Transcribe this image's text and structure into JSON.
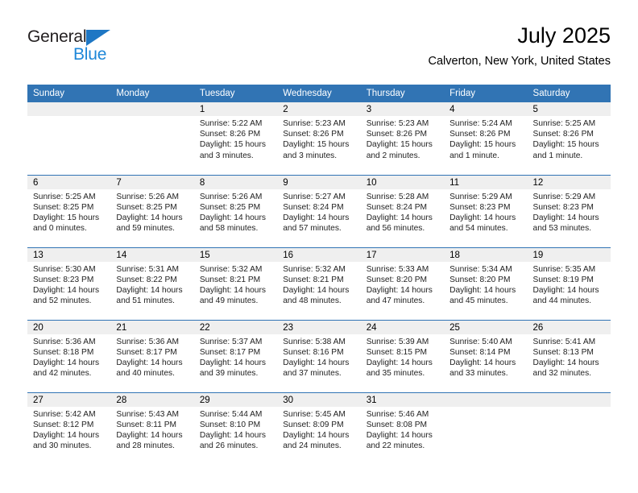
{
  "brand": {
    "name_part1": "General",
    "name_part2": "Blue",
    "triangle_color": "#1e77c4",
    "blue_color": "#1e87d8"
  },
  "header": {
    "title": "July 2025",
    "subtitle": "Calverton, New York, United States"
  },
  "theme": {
    "header_blue": "#3174b4",
    "daynum_band": "#efefef",
    "text": "#222222"
  },
  "weekday_headers": [
    "Sunday",
    "Monday",
    "Tuesday",
    "Wednesday",
    "Thursday",
    "Friday",
    "Saturday"
  ],
  "weeks": [
    [
      {
        "day": "",
        "sunrise": "",
        "sunset": "",
        "daylight1": "",
        "daylight2": ""
      },
      {
        "day": "",
        "sunrise": "",
        "sunset": "",
        "daylight1": "",
        "daylight2": ""
      },
      {
        "day": "1",
        "sunrise": "Sunrise: 5:22 AM",
        "sunset": "Sunset: 8:26 PM",
        "daylight1": "Daylight: 15 hours",
        "daylight2": "and 3 minutes."
      },
      {
        "day": "2",
        "sunrise": "Sunrise: 5:23 AM",
        "sunset": "Sunset: 8:26 PM",
        "daylight1": "Daylight: 15 hours",
        "daylight2": "and 3 minutes."
      },
      {
        "day": "3",
        "sunrise": "Sunrise: 5:23 AM",
        "sunset": "Sunset: 8:26 PM",
        "daylight1": "Daylight: 15 hours",
        "daylight2": "and 2 minutes."
      },
      {
        "day": "4",
        "sunrise": "Sunrise: 5:24 AM",
        "sunset": "Sunset: 8:26 PM",
        "daylight1": "Daylight: 15 hours",
        "daylight2": "and 1 minute."
      },
      {
        "day": "5",
        "sunrise": "Sunrise: 5:25 AM",
        "sunset": "Sunset: 8:26 PM",
        "daylight1": "Daylight: 15 hours",
        "daylight2": "and 1 minute."
      }
    ],
    [
      {
        "day": "6",
        "sunrise": "Sunrise: 5:25 AM",
        "sunset": "Sunset: 8:25 PM",
        "daylight1": "Daylight: 15 hours",
        "daylight2": "and 0 minutes."
      },
      {
        "day": "7",
        "sunrise": "Sunrise: 5:26 AM",
        "sunset": "Sunset: 8:25 PM",
        "daylight1": "Daylight: 14 hours",
        "daylight2": "and 59 minutes."
      },
      {
        "day": "8",
        "sunrise": "Sunrise: 5:26 AM",
        "sunset": "Sunset: 8:25 PM",
        "daylight1": "Daylight: 14 hours",
        "daylight2": "and 58 minutes."
      },
      {
        "day": "9",
        "sunrise": "Sunrise: 5:27 AM",
        "sunset": "Sunset: 8:24 PM",
        "daylight1": "Daylight: 14 hours",
        "daylight2": "and 57 minutes."
      },
      {
        "day": "10",
        "sunrise": "Sunrise: 5:28 AM",
        "sunset": "Sunset: 8:24 PM",
        "daylight1": "Daylight: 14 hours",
        "daylight2": "and 56 minutes."
      },
      {
        "day": "11",
        "sunrise": "Sunrise: 5:29 AM",
        "sunset": "Sunset: 8:23 PM",
        "daylight1": "Daylight: 14 hours",
        "daylight2": "and 54 minutes."
      },
      {
        "day": "12",
        "sunrise": "Sunrise: 5:29 AM",
        "sunset": "Sunset: 8:23 PM",
        "daylight1": "Daylight: 14 hours",
        "daylight2": "and 53 minutes."
      }
    ],
    [
      {
        "day": "13",
        "sunrise": "Sunrise: 5:30 AM",
        "sunset": "Sunset: 8:23 PM",
        "daylight1": "Daylight: 14 hours",
        "daylight2": "and 52 minutes."
      },
      {
        "day": "14",
        "sunrise": "Sunrise: 5:31 AM",
        "sunset": "Sunset: 8:22 PM",
        "daylight1": "Daylight: 14 hours",
        "daylight2": "and 51 minutes."
      },
      {
        "day": "15",
        "sunrise": "Sunrise: 5:32 AM",
        "sunset": "Sunset: 8:21 PM",
        "daylight1": "Daylight: 14 hours",
        "daylight2": "and 49 minutes."
      },
      {
        "day": "16",
        "sunrise": "Sunrise: 5:32 AM",
        "sunset": "Sunset: 8:21 PM",
        "daylight1": "Daylight: 14 hours",
        "daylight2": "and 48 minutes."
      },
      {
        "day": "17",
        "sunrise": "Sunrise: 5:33 AM",
        "sunset": "Sunset: 8:20 PM",
        "daylight1": "Daylight: 14 hours",
        "daylight2": "and 47 minutes."
      },
      {
        "day": "18",
        "sunrise": "Sunrise: 5:34 AM",
        "sunset": "Sunset: 8:20 PM",
        "daylight1": "Daylight: 14 hours",
        "daylight2": "and 45 minutes."
      },
      {
        "day": "19",
        "sunrise": "Sunrise: 5:35 AM",
        "sunset": "Sunset: 8:19 PM",
        "daylight1": "Daylight: 14 hours",
        "daylight2": "and 44 minutes."
      }
    ],
    [
      {
        "day": "20",
        "sunrise": "Sunrise: 5:36 AM",
        "sunset": "Sunset: 8:18 PM",
        "daylight1": "Daylight: 14 hours",
        "daylight2": "and 42 minutes."
      },
      {
        "day": "21",
        "sunrise": "Sunrise: 5:36 AM",
        "sunset": "Sunset: 8:17 PM",
        "daylight1": "Daylight: 14 hours",
        "daylight2": "and 40 minutes."
      },
      {
        "day": "22",
        "sunrise": "Sunrise: 5:37 AM",
        "sunset": "Sunset: 8:17 PM",
        "daylight1": "Daylight: 14 hours",
        "daylight2": "and 39 minutes."
      },
      {
        "day": "23",
        "sunrise": "Sunrise: 5:38 AM",
        "sunset": "Sunset: 8:16 PM",
        "daylight1": "Daylight: 14 hours",
        "daylight2": "and 37 minutes."
      },
      {
        "day": "24",
        "sunrise": "Sunrise: 5:39 AM",
        "sunset": "Sunset: 8:15 PM",
        "daylight1": "Daylight: 14 hours",
        "daylight2": "and 35 minutes."
      },
      {
        "day": "25",
        "sunrise": "Sunrise: 5:40 AM",
        "sunset": "Sunset: 8:14 PM",
        "daylight1": "Daylight: 14 hours",
        "daylight2": "and 33 minutes."
      },
      {
        "day": "26",
        "sunrise": "Sunrise: 5:41 AM",
        "sunset": "Sunset: 8:13 PM",
        "daylight1": "Daylight: 14 hours",
        "daylight2": "and 32 minutes."
      }
    ],
    [
      {
        "day": "27",
        "sunrise": "Sunrise: 5:42 AM",
        "sunset": "Sunset: 8:12 PM",
        "daylight1": "Daylight: 14 hours",
        "daylight2": "and 30 minutes."
      },
      {
        "day": "28",
        "sunrise": "Sunrise: 5:43 AM",
        "sunset": "Sunset: 8:11 PM",
        "daylight1": "Daylight: 14 hours",
        "daylight2": "and 28 minutes."
      },
      {
        "day": "29",
        "sunrise": "Sunrise: 5:44 AM",
        "sunset": "Sunset: 8:10 PM",
        "daylight1": "Daylight: 14 hours",
        "daylight2": "and 26 minutes."
      },
      {
        "day": "30",
        "sunrise": "Sunrise: 5:45 AM",
        "sunset": "Sunset: 8:09 PM",
        "daylight1": "Daylight: 14 hours",
        "daylight2": "and 24 minutes."
      },
      {
        "day": "31",
        "sunrise": "Sunrise: 5:46 AM",
        "sunset": "Sunset: 8:08 PM",
        "daylight1": "Daylight: 14 hours",
        "daylight2": "and 22 minutes."
      },
      {
        "day": "",
        "sunrise": "",
        "sunset": "",
        "daylight1": "",
        "daylight2": ""
      },
      {
        "day": "",
        "sunrise": "",
        "sunset": "",
        "daylight1": "",
        "daylight2": ""
      }
    ]
  ]
}
